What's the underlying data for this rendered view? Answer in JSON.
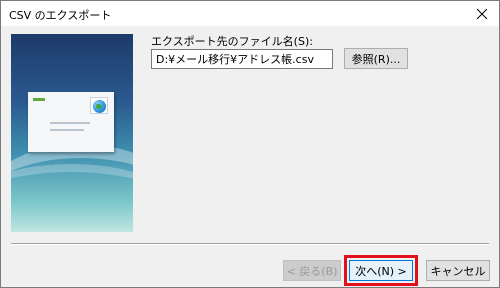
{
  "window": {
    "title": "CSV のエクスポート"
  },
  "form": {
    "file_label": "エクスポート先のファイル名(S):",
    "file_value": "D:¥メール移行¥アドレス帳.csv",
    "browse_label": "参照(R)..."
  },
  "footer": {
    "back_label": "< 戻る(B)",
    "next_label": "次へ(N) >",
    "cancel_label": "キャンセル"
  },
  "colors": {
    "highlight": "#e0101e",
    "focus_border": "#0078d7"
  },
  "icons": {
    "close": "close-icon",
    "art": "address-book-envelope-illustration"
  }
}
